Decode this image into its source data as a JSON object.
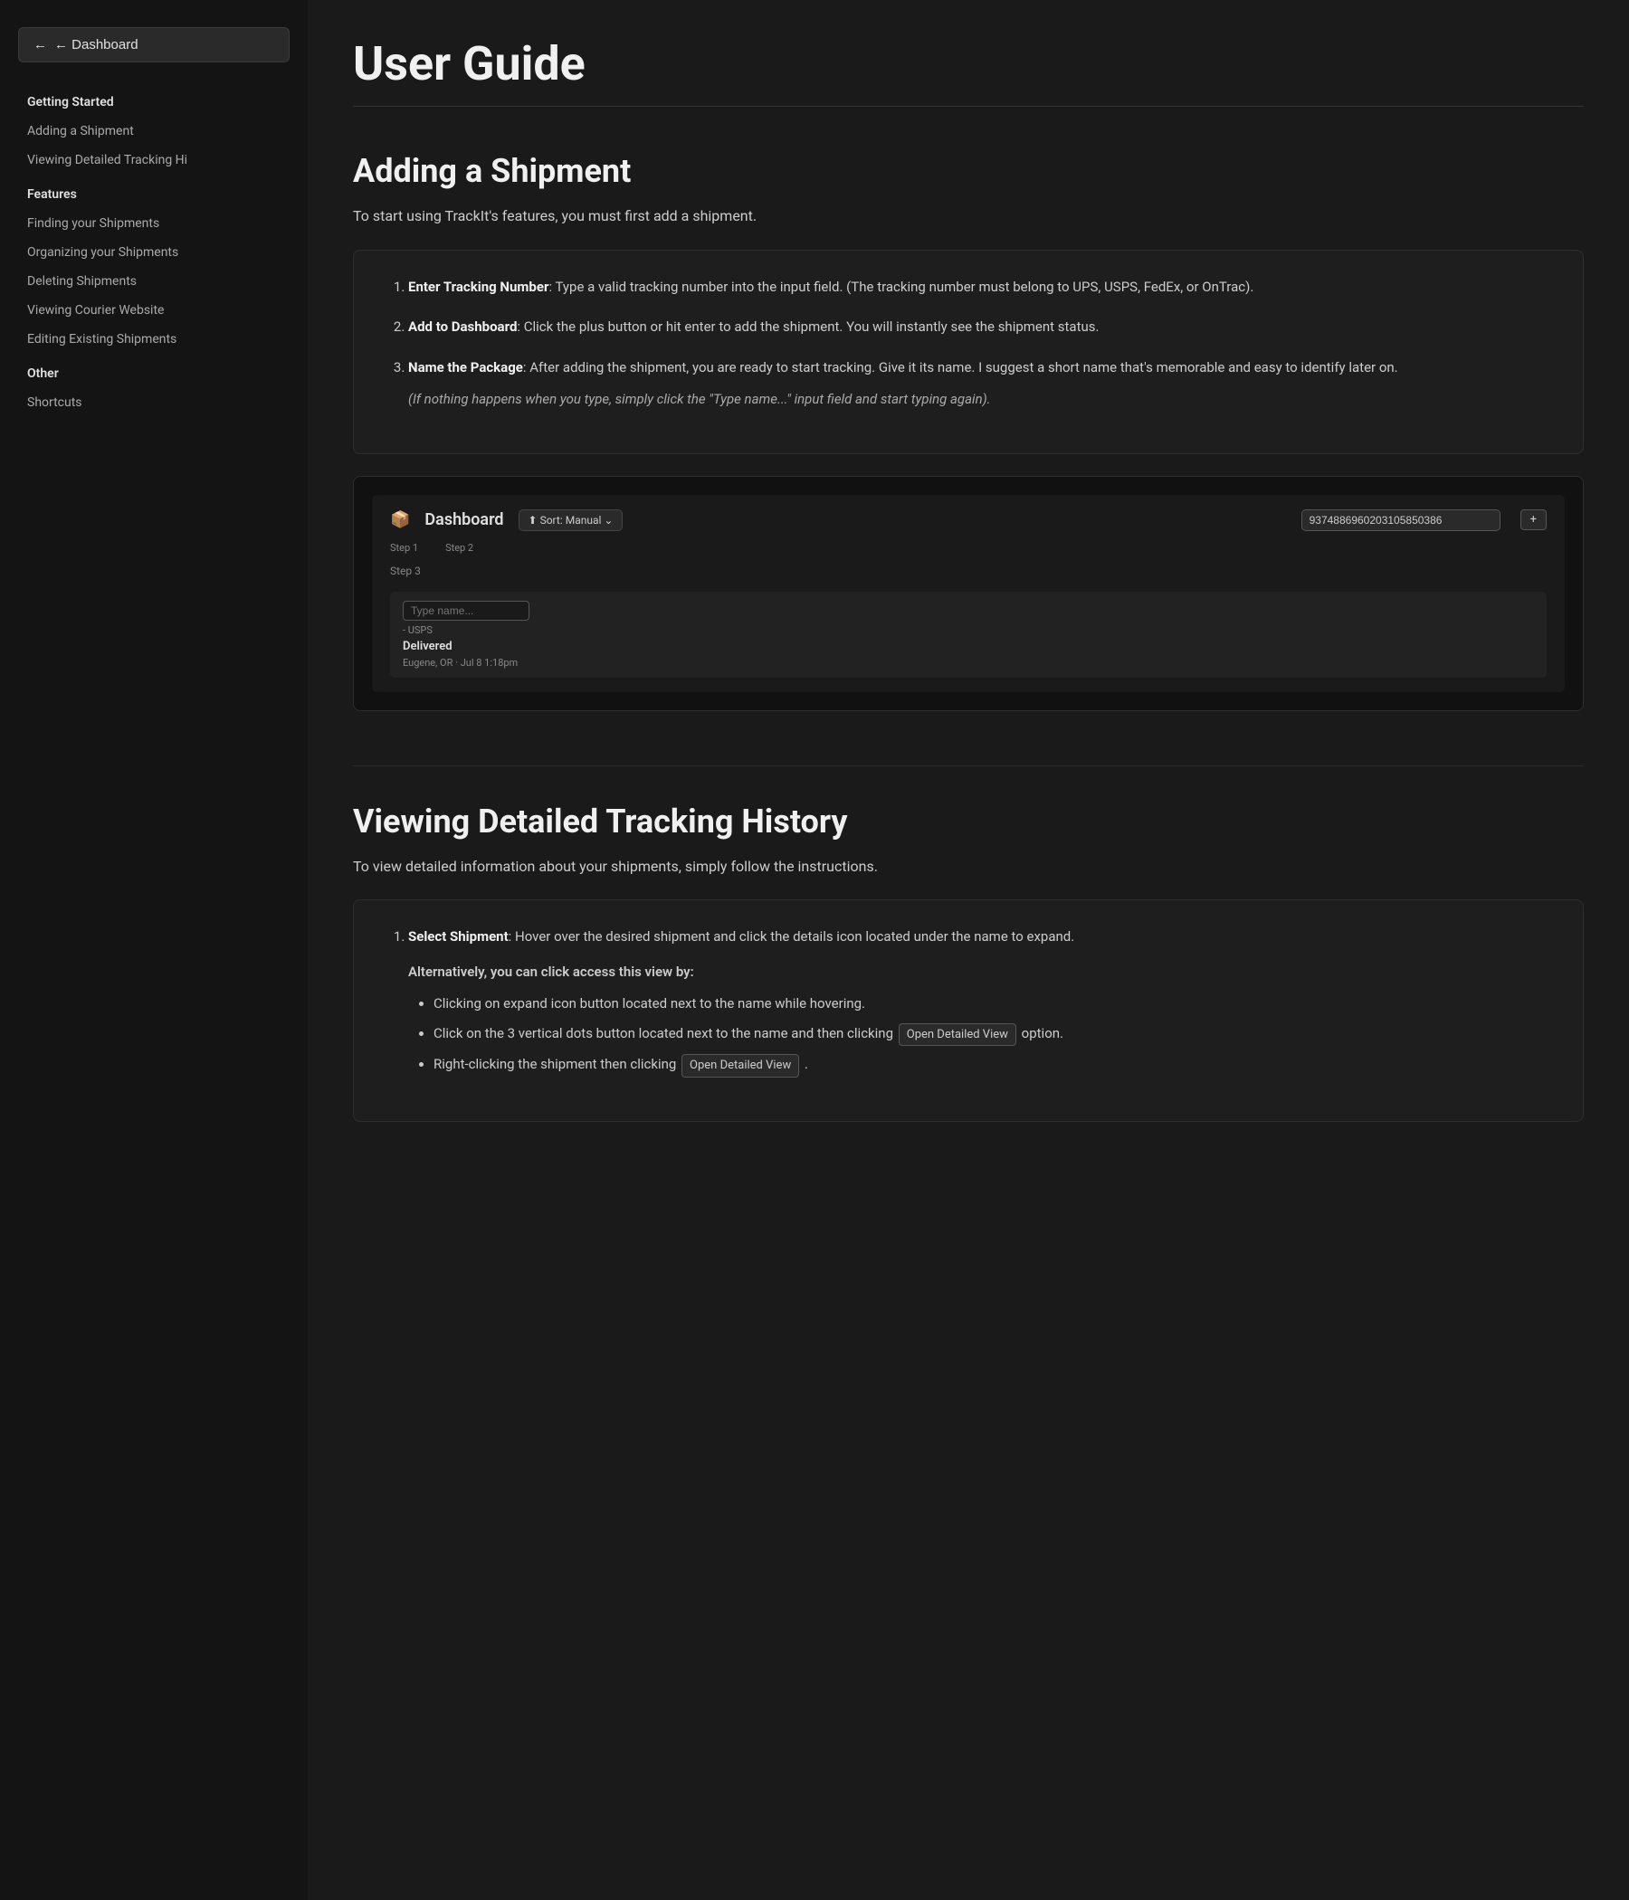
{
  "sidebar": {
    "dashboard_button": "← Dashboard",
    "sections": [
      {
        "label": "Getting Started",
        "type": "header",
        "items": [
          {
            "label": "Adding a Shipment"
          },
          {
            "label": "Viewing Detailed Tracking Hi"
          }
        ]
      },
      {
        "label": "Features",
        "type": "header",
        "items": [
          {
            "label": "Finding your Shipments"
          },
          {
            "label": "Organizing your Shipments"
          },
          {
            "label": "Deleting Shipments"
          },
          {
            "label": "Viewing Courier Website"
          },
          {
            "label": "Editing Existing Shipments"
          }
        ]
      },
      {
        "label": "Other",
        "type": "header",
        "items": [
          {
            "label": "Shortcuts"
          }
        ]
      }
    ]
  },
  "main": {
    "page_title": "User Guide",
    "sections": [
      {
        "id": "adding-shipment",
        "title": "Adding a Shipment",
        "description": "To start using TrackIt's features, you must first add a shipment.",
        "steps": [
          {
            "label": "Enter Tracking Number",
            "text": ": Type a valid tracking number into the input field. (The tracking number must belong to UPS, USPS, FedEx, or OnTrac)."
          },
          {
            "label": "Add to Dashboard",
            "text": ": Click the plus button or hit enter to add the shipment. You will instantly see the shipment status."
          },
          {
            "label": "Name the Package",
            "text": ": After adding the shipment, you are ready to start tracking. Give it its name. I suggest a short name that's memorable and easy to identify later on."
          }
        ],
        "indent_note": "(If nothing happens when you type, simply click the \"Type name...\" input field and start typing again)."
      },
      {
        "id": "viewing-tracking",
        "title": "Viewing Detailed Tracking History",
        "description": "To view detailed information about your shipments, simply follow the instructions.",
        "steps": [
          {
            "label": "Select Shipment",
            "text": ": Hover over the desired shipment and click the details icon located under the name to expand.",
            "sub_note": "Alternatively, you can click access this view by:",
            "bullets": [
              "Clicking on expand icon button located next to the name while hovering.",
              "Click on the 3 vertical dots button located next to the name and then clicking Open Detailed View option.",
              "Right-clicking the shipment then clicking Open Detailed View."
            ]
          }
        ]
      }
    ],
    "fake_screenshot": {
      "dashboard_label": "Dashboard",
      "sort_btn": "⬆ Sort: Manual ⌄",
      "tracking_input_value": "9374886960203105850386",
      "step1": "Step 1",
      "step2": "Step 2",
      "step3_label": "Step 3",
      "name_placeholder": "Type name...",
      "courier": "- USPS",
      "status": "Delivered",
      "status_detail": "Eugene, OR · Jul 8 1:18pm",
      "open_detail_badge": "Open Detailed View"
    }
  }
}
